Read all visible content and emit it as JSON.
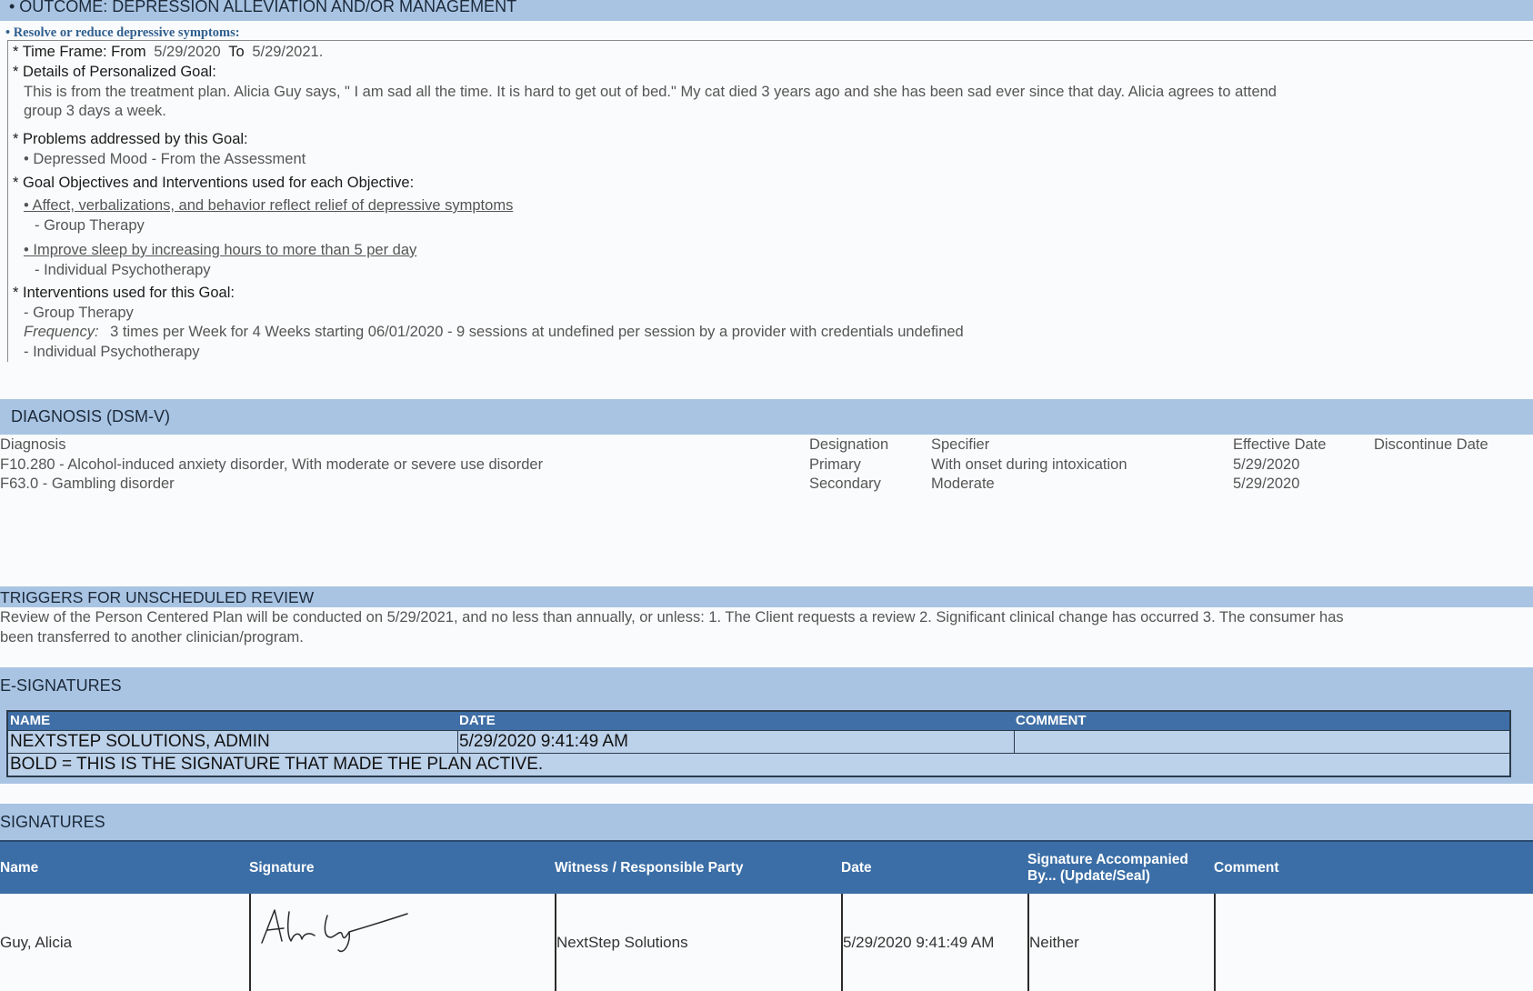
{
  "outcome": {
    "header": "•  OUTCOME: DEPRESSION ALLEVIATION AND/OR MANAGEMENT",
    "goal_line": "• Resolve or reduce depressive symptoms:",
    "time_frame": {
      "label_from": "* Time Frame: From",
      "from": "5/29/2020",
      "label_to": "To",
      "to": "5/29/2021."
    },
    "details_label": "* Details of Personalized Goal:",
    "details_text_1": "This is from the treatment plan.   Alicia Guy says, \" I am sad all the time.  It is hard to get out of bed.\"  My cat died 3 years ago and she has been sad ever since that day.  Alicia agrees to attend",
    "details_text_2": "group 3 days a week.",
    "problems_label": "* Problems addressed by this Goal:",
    "problems": [
      "• Depressed Mood - From the Assessment"
    ],
    "objectives_label": "* Goal Objectives and Interventions used for each Objective:",
    "objectives": [
      {
        "name": "• Affect, verbalizations, and behavior reflect relief of depressive symptoms",
        "intervention": "- Group Therapy"
      },
      {
        "name": "• Improve sleep by increasing hours to more than 5 per day",
        "intervention": "- Individual Psychotherapy"
      }
    ],
    "interventions_label": "* Interventions used for this Goal:",
    "intervention_1": "- Group Therapy",
    "frequency_label": "Frequency:",
    "frequency_text": "3 times per Week for 4 Weeks starting 06/01/2020 - 9 sessions at undefined  per session by a provider with credentials undefined",
    "intervention_2": "- Individual Psychotherapy"
  },
  "diagnosis": {
    "header": "DIAGNOSIS (DSM-V)",
    "columns": [
      "Diagnosis",
      "Designation",
      "Specifier",
      "Effective Date",
      "Discontinue Date"
    ],
    "rows": [
      [
        "F10.280 - Alcohol-induced anxiety disorder, With moderate or severe use disorder",
        "Primary",
        "With onset during intoxication",
        "5/29/2020",
        ""
      ],
      [
        "F63.0 - Gambling disorder",
        "Secondary",
        "Moderate",
        "5/29/2020",
        ""
      ]
    ]
  },
  "triggers": {
    "header": "TRIGGERS FOR UNSCHEDULED REVIEW",
    "text_1": "Review of the Person Centered Plan will be conducted on 5/29/2021, and no less than annually, or unless: 1. The Client requests a review 2. Significant clinical change has occurred 3. The consumer has",
    "text_2": "been transferred to another clinician/program."
  },
  "esignatures": {
    "header": "E-SIGNATURES",
    "columns": [
      "NAME",
      "DATE",
      "COMMENT"
    ],
    "row": [
      "NEXTSTEP SOLUTIONS, ADMIN",
      "5/29/2020 9:41:49 AM",
      ""
    ],
    "note": "BOLD = THIS IS THE SIGNATURE THAT MADE THE PLAN ACTIVE."
  },
  "signatures": {
    "header": "SIGNATURES",
    "columns": [
      "Name",
      "Signature",
      "Witness / Responsible Party",
      "Date",
      "Signature Accompanied By... (Update/Seal)",
      "Comment"
    ],
    "row": [
      "Guy, Alicia",
      "",
      "NextStep Solutions",
      "5/29/2020 9:41:49 AM",
      "Neither",
      ""
    ]
  },
  "colors": {
    "band": "#a9c4e3",
    "table_header": "#3b6ea6",
    "esig_row": "#bcd1ea"
  }
}
